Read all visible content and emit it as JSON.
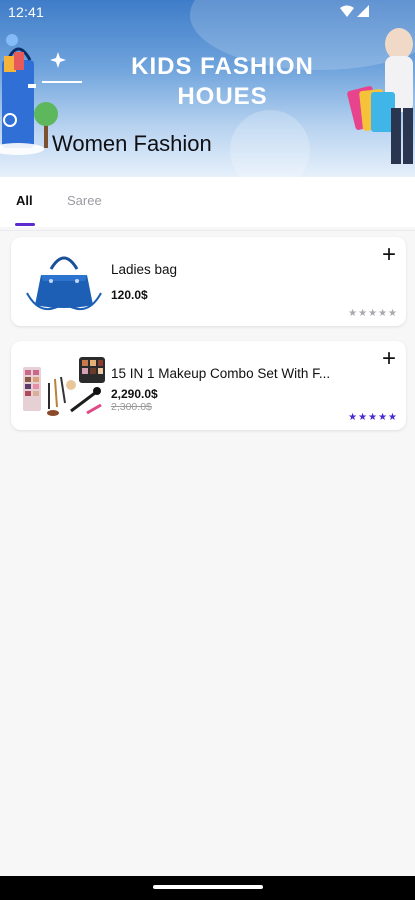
{
  "status_bar": {
    "time": "12:41"
  },
  "banner": {
    "title_line1": "KIDS FASHION",
    "title_line2": "HOUES",
    "subtitle": "Women Fashion"
  },
  "tabs": [
    {
      "label": "All",
      "active": true
    },
    {
      "label": "Saree",
      "active": false
    }
  ],
  "products": [
    {
      "name": "Ladies bag",
      "price": "120.0$",
      "old_price": "",
      "stars": "★★★★★",
      "star_color": "#a8a8ae"
    },
    {
      "name": "15 IN 1 Makeup Combo Set With F...",
      "price": "2,290.0$",
      "old_price": "2,300.0$",
      "stars": "★★★★★",
      "star_color": "#4b2bd0"
    }
  ],
  "colors": {
    "accent": "#5b2bd0",
    "banner_top": "#3f7cc8",
    "bag_blue": "#1d5fb5"
  },
  "icons": [
    "wifi-icon",
    "signal-icon",
    "plus-icon",
    "handbag-icon",
    "makeup-set-icon",
    "star-icon"
  ]
}
